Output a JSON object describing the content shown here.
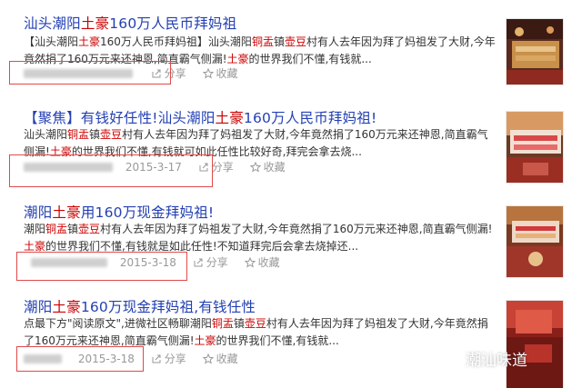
{
  "results": [
    {
      "title": [
        "汕头潮阳",
        "土豪",
        "160万人民币拜妈祖"
      ],
      "snippet": "【汕头潮阳<hl>土豪</hl>160万人民币拜妈祖】汕头潮阳<hl>铜盂</hl>镇<hl>壶豆</hl>村有人去年因为拜了妈祖发了大财,今年竟然捐了160万元来还神恩,简直霸气侧漏!<hl>土豪</hl>的世界我们不懂,有钱就...",
      "date": "",
      "share": "分享",
      "collect": "收藏"
    },
    {
      "title": [
        "【聚焦】有钱好任性!汕头潮阳",
        "土豪",
        "160万人民币拜妈祖!"
      ],
      "snippet": "汕头潮阳<hl>铜盂</hl>镇<hl>壶豆</hl>村有人去年因为拜了妈祖发了大财,今年竟然捐了160万元来还神恩,简直霸气侧漏!<hl>土豪</hl>的世界我们不懂,有钱就可如此任性比较好奇,拜完会拿去烧...",
      "date": "2015-3-17",
      "share": "分享",
      "collect": "收藏"
    },
    {
      "title": [
        "潮阳",
        "土豪",
        "用160万现金拜妈祖!"
      ],
      "snippet": "潮阳<hl>铜盂</hl>镇<hl>壶豆</hl>村有人去年因为拜了妈祖发了大财,今年竟然捐了160万元来还神恩,简直霸气侧漏!<hl>土豪</hl>的世界我们不懂,有钱就是如此任性!不知道拜完后会拿去烧掉还...",
      "date": "2015-3-18",
      "share": "分享",
      "collect": "收藏"
    },
    {
      "title": [
        "潮阳",
        "土豪",
        "160万现金拜妈祖,有钱任性"
      ],
      "snippet": "点最下方\"阅读原文\",进微社区畅聊潮阳<hl>铜盂</hl>镇<hl>壶豆</hl>村有人去年因为拜了妈祖发了大财,今年竟然捐了160万元来还神恩,简直霸气侧漏!<hl>土豪</hl>的世界我们不懂,有钱就...",
      "date": "2015-3-18",
      "share": "分享",
      "collect": "收藏"
    }
  ],
  "watermark": {
    "text": "潮汕味道",
    "icon": "wechat-icon"
  },
  "colors": {
    "title": "#2440b3",
    "highlight": "#cc0000",
    "meta": "#999999",
    "box": "#e04a4a"
  }
}
